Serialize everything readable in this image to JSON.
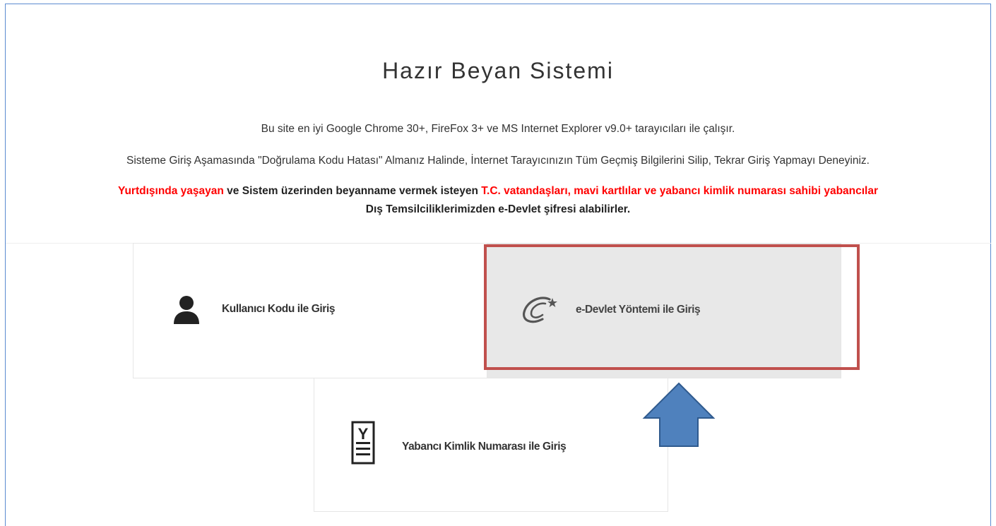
{
  "page": {
    "title": "Hazır Beyan Sistemi",
    "info_line_1": "Bu site en iyi Google Chrome 30+, FireFox 3+ ve MS Internet Explorer v9.0+ tarayıcıları ile çalışır.",
    "info_line_2": "Sisteme Giriş Aşamasında \"Doğrulama Kodu Hatası\" Almanız Halinde, İnternet Tarayıcınızın Tüm Geçmiş Bilgilerini Silip, Tekrar Giriş Yapmayı Deneyiniz.",
    "warning": {
      "part1": "Yurtdışında yaşayan",
      "part2": " ve Sistem üzerinden beyanname vermek isteyen ",
      "part3": "T.C. vatandaşları, mavi kartlılar ve yabancı kimlik numarası sahibi yabancılar",
      "line2": "Dış Temsilciliklerimizden e-Devlet şifresi alabilirler."
    }
  },
  "login_options": [
    {
      "label": "Kullanıcı Kodu ile Giriş",
      "icon": "user-icon"
    },
    {
      "label": "e-Devlet Yöntemi ile Giriş",
      "icon": "edevlet-logo-icon"
    },
    {
      "label": "Yabancı Kimlik Numarası ile Giriş",
      "icon": "id-document-icon"
    }
  ],
  "annotation": {
    "highlight_color": "#c0504d",
    "arrow_color": "#4f81bd",
    "arrow_icon": "up-arrow-icon"
  }
}
